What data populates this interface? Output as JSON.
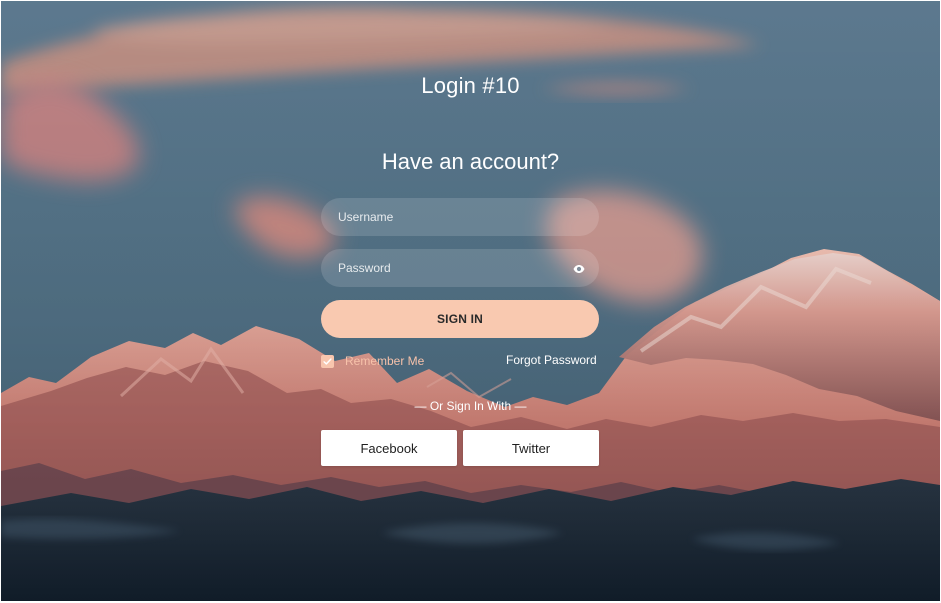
{
  "page": {
    "title": "Login #10",
    "subtitle": "Have an account?"
  },
  "form": {
    "username_placeholder": "Username",
    "password_placeholder": "Password",
    "sign_in_label": "SIGN IN",
    "remember_me_label": "Remember Me",
    "remember_me_checked": true,
    "forgot_password_label": "Forgot Password",
    "alt_sign_in_label": "— Or Sign In With —"
  },
  "social": {
    "facebook_label": "Facebook",
    "twitter_label": "Twitter"
  },
  "icons": {
    "password_toggle": "eye-icon",
    "remember_check": "check-icon"
  },
  "theme": {
    "accent": "#f9c9b0",
    "text": "#ffffff",
    "button_text": "#2a2a2a",
    "social_bg": "#ffffff"
  }
}
